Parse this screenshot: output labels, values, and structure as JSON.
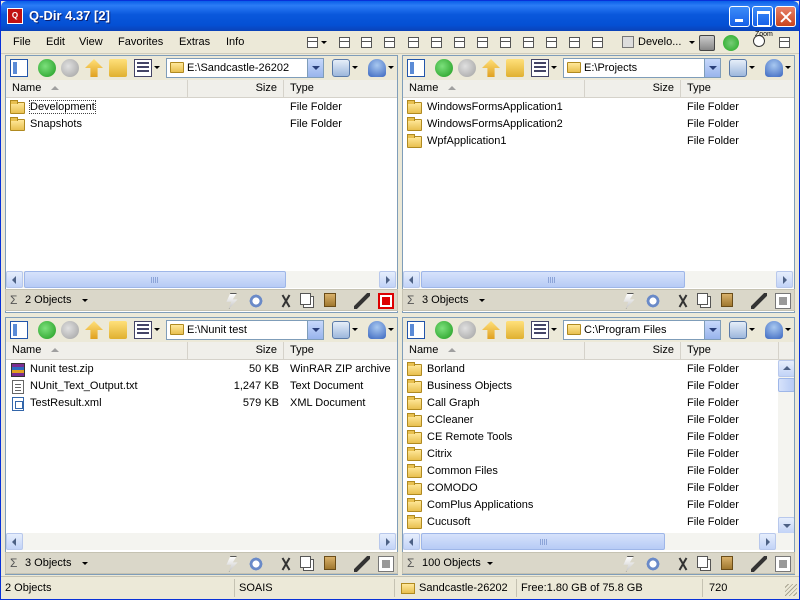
{
  "window": {
    "title": "Q-Dir 4.37 [2]",
    "app_icon_label": "Q"
  },
  "menu": {
    "items": [
      "File",
      "Edit",
      "View",
      "Favorites",
      "Extras",
      "Info"
    ],
    "path_button_label": "Develo...",
    "zoom_label": "Zoom"
  },
  "panes": [
    {
      "address": "E:\\Sandcastle-26202",
      "columns": {
        "name": "Name",
        "size": "Size",
        "type": "Type"
      },
      "rows": [
        {
          "icon": "folder-icon",
          "name": "Development",
          "size": "",
          "type": "File Folder",
          "selected": true
        },
        {
          "icon": "folder-icon",
          "name": "Snapshots",
          "size": "",
          "type": "File Folder"
        }
      ],
      "status": "2 Objects"
    },
    {
      "address": "E:\\Projects",
      "columns": {
        "name": "Name",
        "size": "Size",
        "type": "Type"
      },
      "rows": [
        {
          "icon": "folder-icon",
          "name": "WindowsFormsApplication1",
          "size": "",
          "type": "File Folder"
        },
        {
          "icon": "folder-icon",
          "name": "WindowsFormsApplication2",
          "size": "",
          "type": "File Folder"
        },
        {
          "icon": "folder-icon",
          "name": "WpfApplication1",
          "size": "",
          "type": "File Folder"
        }
      ],
      "status": "3 Objects"
    },
    {
      "address": "E:\\Nunit test",
      "columns": {
        "name": "Name",
        "size": "Size",
        "type": "Type"
      },
      "rows": [
        {
          "icon": "zip-icon",
          "name": "Nunit test.zip",
          "size": "50 KB",
          "type": "WinRAR ZIP archive"
        },
        {
          "icon": "text-file-icon",
          "name": "NUnit_Text_Output.txt",
          "size": "1,247 KB",
          "type": "Text Document"
        },
        {
          "icon": "xml-file-icon",
          "name": "TestResult.xml",
          "size": "579 KB",
          "type": "XML Document"
        }
      ],
      "status": "3 Objects"
    },
    {
      "address": "C:\\Program Files",
      "columns": {
        "name": "Name",
        "size": "Size",
        "type": "Type"
      },
      "rows": [
        {
          "icon": "folder-icon",
          "name": "Borland",
          "size": "",
          "type": "File Folder"
        },
        {
          "icon": "folder-icon",
          "name": "Business Objects",
          "size": "",
          "type": "File Folder"
        },
        {
          "icon": "folder-icon",
          "name": "Call Graph",
          "size": "",
          "type": "File Folder"
        },
        {
          "icon": "folder-icon",
          "name": "CCleaner",
          "size": "",
          "type": "File Folder"
        },
        {
          "icon": "folder-icon",
          "name": "CE Remote Tools",
          "size": "",
          "type": "File Folder"
        },
        {
          "icon": "folder-icon",
          "name": "Citrix",
          "size": "",
          "type": "File Folder"
        },
        {
          "icon": "folder-icon",
          "name": "Common Files",
          "size": "",
          "type": "File Folder"
        },
        {
          "icon": "folder-icon",
          "name": "COMODO",
          "size": "",
          "type": "File Folder"
        },
        {
          "icon": "folder-icon",
          "name": "ComPlus Applications",
          "size": "",
          "type": "File Folder"
        },
        {
          "icon": "folder-icon",
          "name": "Cucusoft",
          "size": "",
          "type": "File Folder"
        }
      ],
      "status": "100 Objects"
    }
  ],
  "statusbar": {
    "objects": "2 Objects",
    "user": "SOAIS",
    "folder": "Sandcastle-26202",
    "free": "Free:1.80 GB of 75.8 GB",
    "number": "720"
  }
}
